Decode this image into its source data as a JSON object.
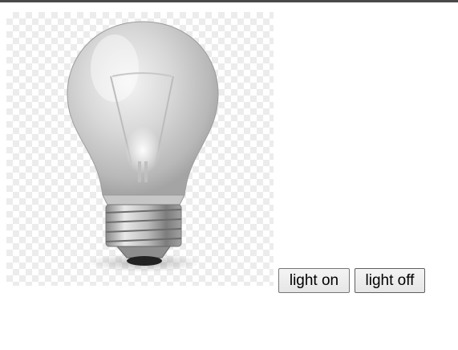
{
  "controls": {
    "light_on_label": "light on",
    "light_off_label": "light off"
  },
  "bulb": {
    "state": "off",
    "image_icon": "light-bulb-icon"
  },
  "colors": {
    "page_background": "#ffffff",
    "top_bar": "#4a4a4a",
    "button_border": "#767676"
  }
}
